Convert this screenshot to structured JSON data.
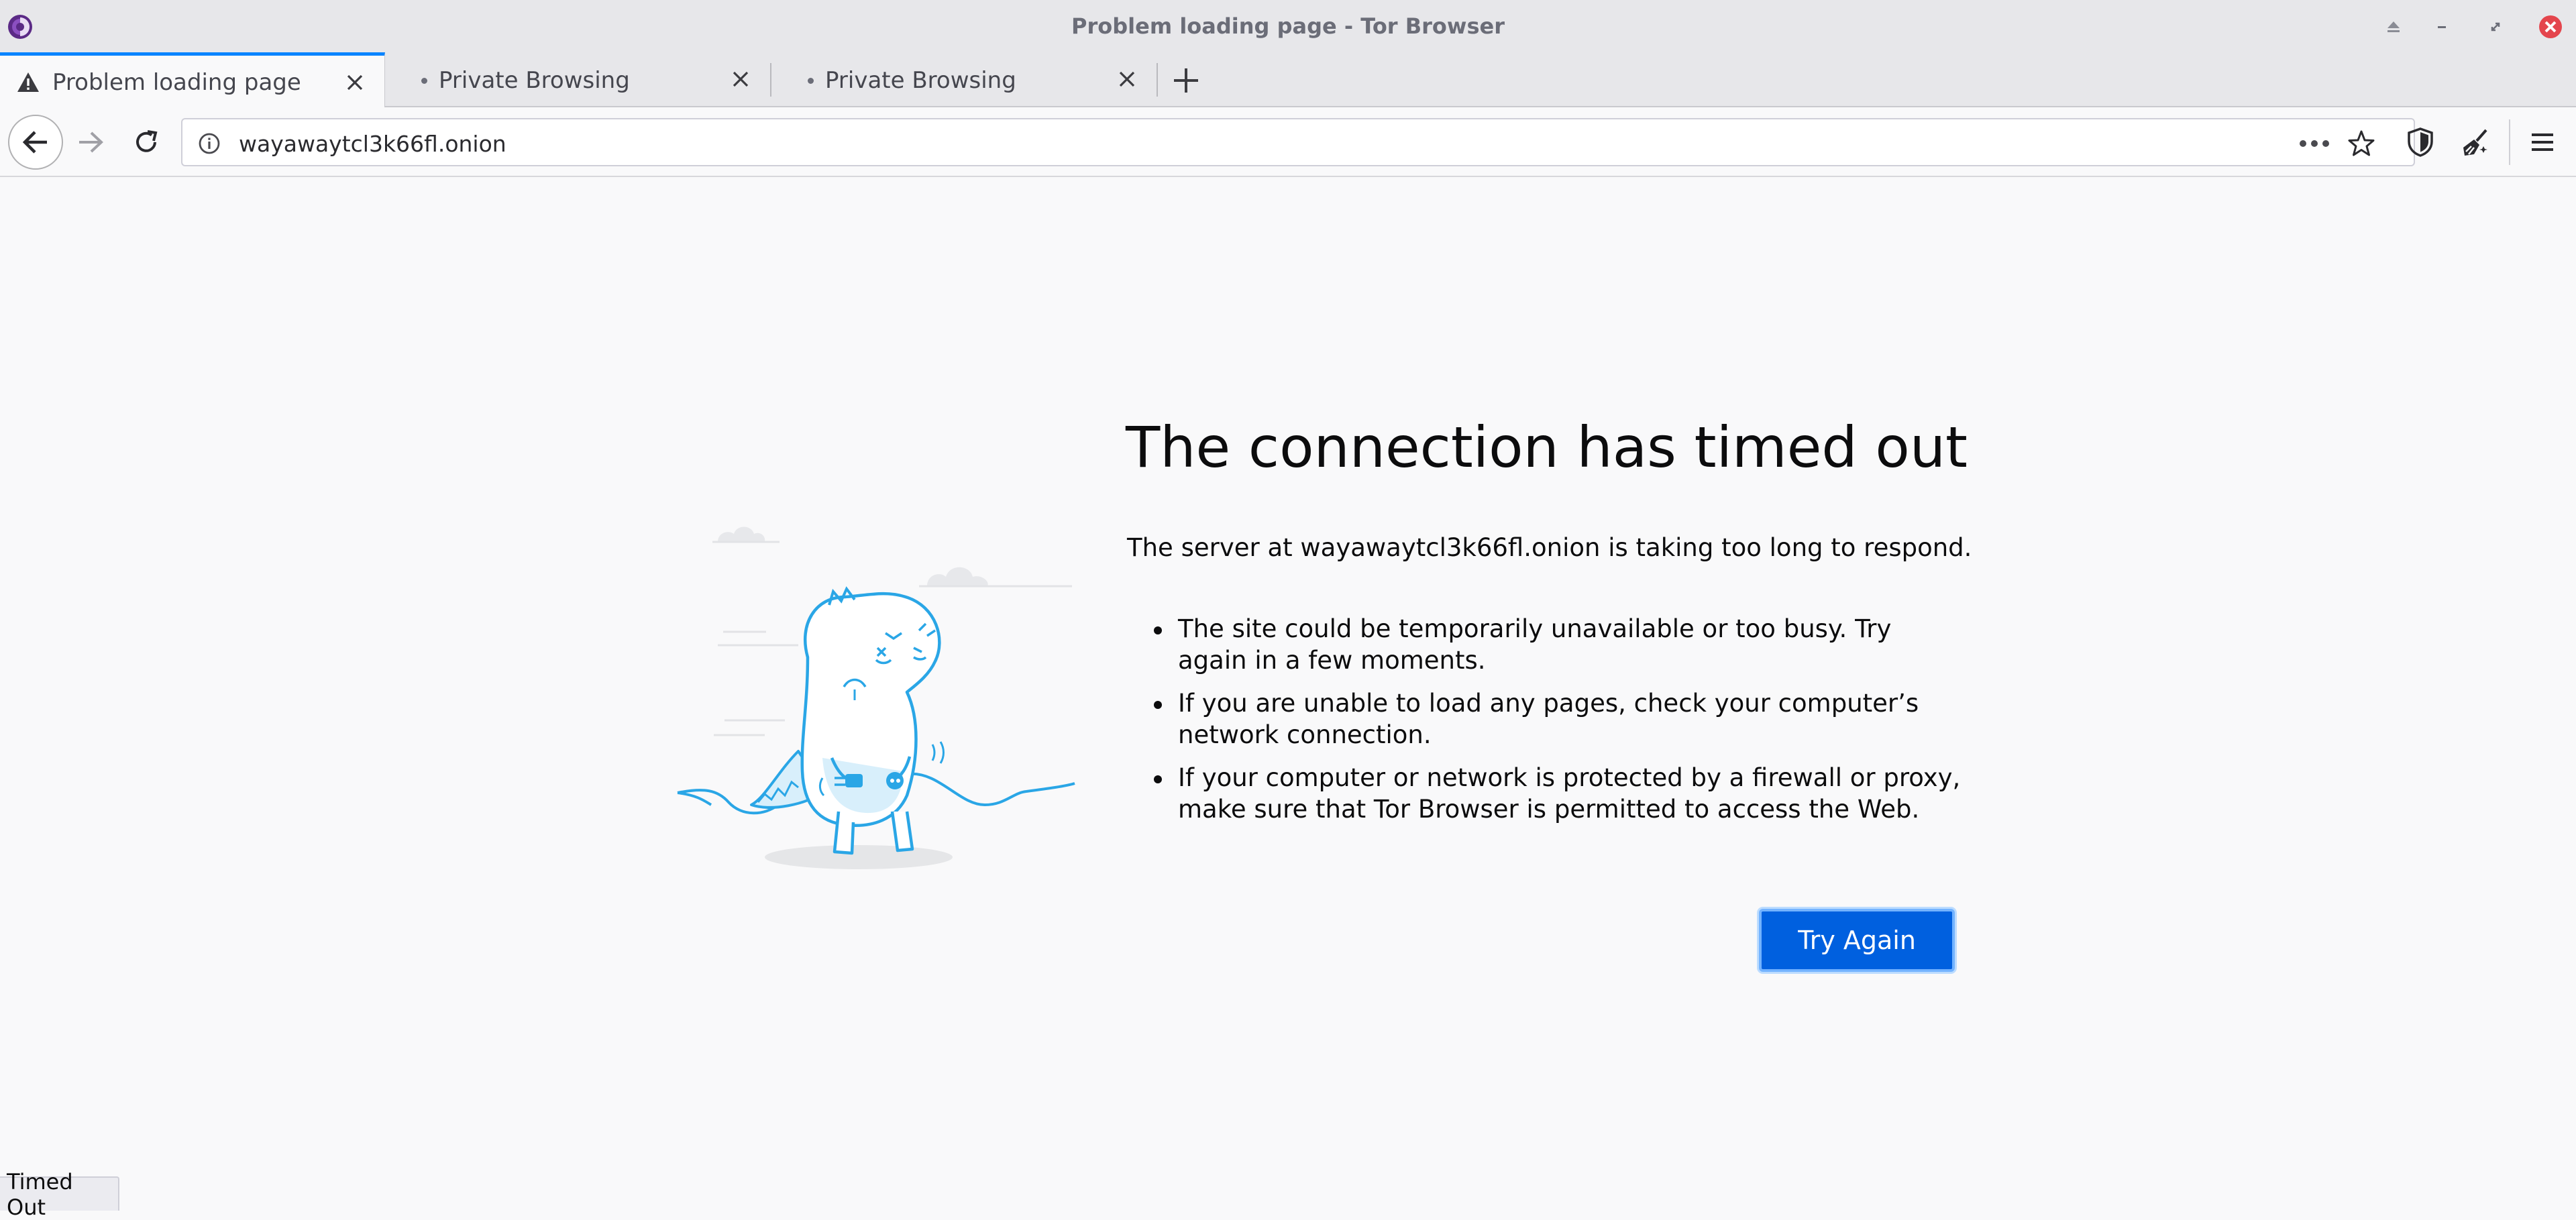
{
  "window": {
    "title": "Problem loading page - Tor Browser"
  },
  "tabs": [
    {
      "label": "Problem loading page",
      "active": true,
      "icon": "warning-icon"
    },
    {
      "label": "Private Browsing",
      "active": false,
      "icon": "dot-icon"
    },
    {
      "label": "Private Browsing",
      "active": false,
      "icon": "dot-icon"
    }
  ],
  "navbar": {
    "url": "wayawaytcl3k66fl.onion"
  },
  "error_page": {
    "title": "The connection has timed out",
    "description": "The server at wayawaytcl3k66fl.onion is taking too long to respond.",
    "bullets": [
      "The site could be temporarily unavailable or too busy. Try again in a few moments.",
      "If you are unable to load any pages, check your computer’s network connection.",
      "If your computer or network is protected by a firewall or proxy, make sure that Tor Browser is permitted to access the Web."
    ],
    "try_again_label": "Try Again"
  },
  "status": {
    "text": "Timed Out"
  },
  "colors": {
    "accent": "#0a84ff",
    "button": "#0060df",
    "close": "#e4454d",
    "illustration": "#2aa6e6"
  }
}
